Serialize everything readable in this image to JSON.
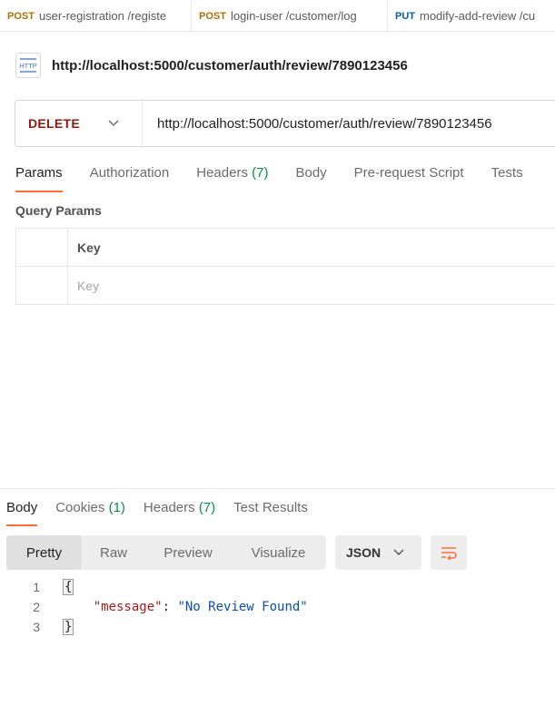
{
  "tabs": [
    {
      "method": "POST",
      "name": "user-registration /registe"
    },
    {
      "method": "POST",
      "name": "login-user /customer/log"
    },
    {
      "method": "PUT",
      "name": "modify-add-review /cu"
    }
  ],
  "request": {
    "icon_text": "HTTP",
    "title": "http://localhost:5000/customer/auth/review/7890123456",
    "method": "DELETE",
    "url": "http://localhost:5000/customer/auth/review/7890123456"
  },
  "request_tabs": [
    {
      "label": "Params",
      "count": ""
    },
    {
      "label": "Authorization",
      "count": ""
    },
    {
      "label": "Headers",
      "count": "(7)"
    },
    {
      "label": "Body",
      "count": ""
    },
    {
      "label": "Pre-request Script",
      "count": ""
    },
    {
      "label": "Tests",
      "count": ""
    }
  ],
  "query_params": {
    "label": "Query Params",
    "column_key": "Key",
    "key_placeholder": "Key"
  },
  "response_tabs": [
    {
      "label": "Body",
      "count": ""
    },
    {
      "label": "Cookies",
      "count": "(1)"
    },
    {
      "label": "Headers",
      "count": "(7)"
    },
    {
      "label": "Test Results",
      "count": ""
    }
  ],
  "view_modes": [
    "Pretty",
    "Raw",
    "Preview",
    "Visualize"
  ],
  "format": "JSON",
  "code": {
    "line_numbers": [
      "1",
      "2",
      "3"
    ],
    "open_brace": "{",
    "close_brace": "}",
    "key": "\"message\"",
    "colon": ": ",
    "value": "\"No Review Found\""
  },
  "colors": {
    "accent": "#ff6c37",
    "delete_method": "#8e1a10",
    "post_method": "#a8700a",
    "put_method": "#0b5cad",
    "count_green": "#0a8a4d"
  }
}
